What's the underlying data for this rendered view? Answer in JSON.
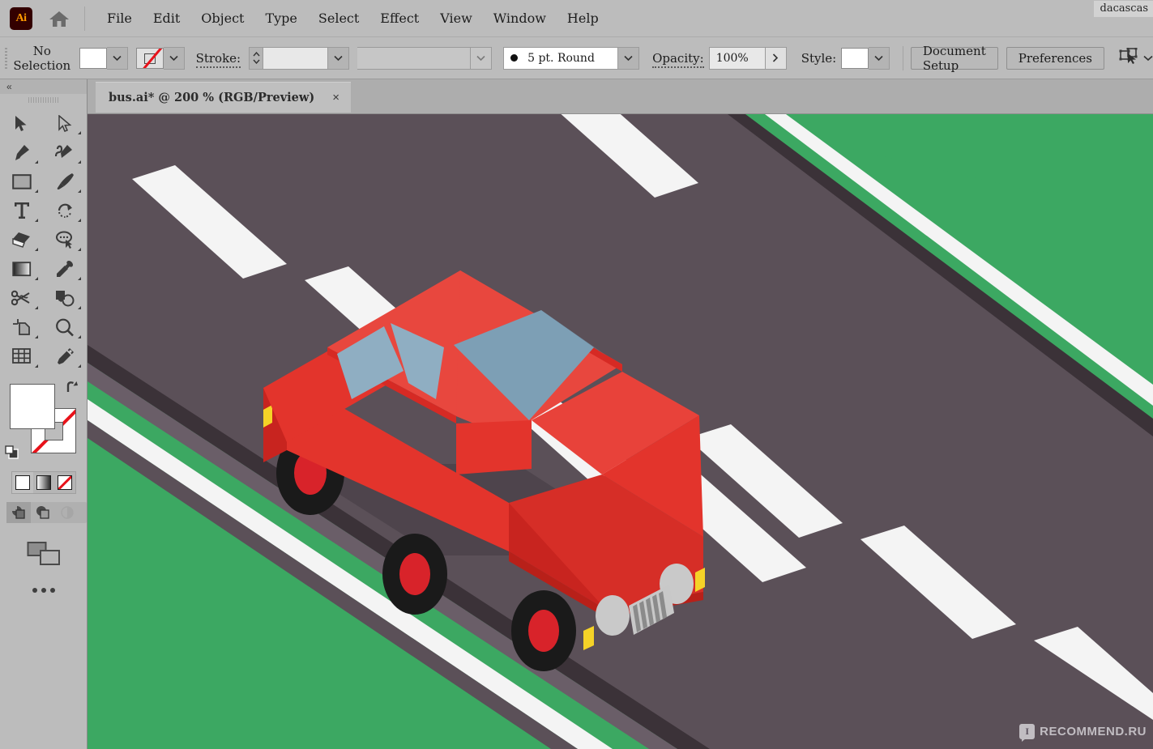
{
  "app": {
    "name": "Adobe Illustrator",
    "logo_text": "Ai",
    "user_tag": "dacascas",
    "accent_color": "#1473c8"
  },
  "menubar": {
    "items": [
      {
        "label": "File",
        "name": "menu-file"
      },
      {
        "label": "Edit",
        "name": "menu-edit"
      },
      {
        "label": "Object",
        "name": "menu-object"
      },
      {
        "label": "Type",
        "name": "menu-type"
      },
      {
        "label": "Select",
        "name": "menu-select"
      },
      {
        "label": "Effect",
        "name": "menu-effect"
      },
      {
        "label": "View",
        "name": "menu-view"
      },
      {
        "label": "Window",
        "name": "menu-window"
      },
      {
        "label": "Help",
        "name": "menu-help"
      }
    ],
    "home_icon": "home-icon"
  },
  "controlbar": {
    "selection_status": "No Selection",
    "fill_swatch": "#FFFFFF",
    "stroke_swatch": "none",
    "stroke_label": "Stroke:",
    "stroke_weight": "",
    "stroke_profile": "",
    "brush_definition": "5 pt. Round",
    "opacity_label": "Opacity:",
    "opacity_value": "100%",
    "style_label": "Style:",
    "style_swatch": "#FFFFFF",
    "document_setup": "Document Setup",
    "preferences": "Preferences",
    "select_similar_icon": "select-similar-objects-icon"
  },
  "tabs": {
    "active": 0,
    "items": [
      {
        "title": "bus.ai* @ 200 % (RGB/Preview)",
        "close": "×"
      }
    ]
  },
  "toolpanel": {
    "collapse_label": "«",
    "tools": [
      {
        "name": "selection-tool",
        "label": "Selection"
      },
      {
        "name": "direct-selection-tool",
        "label": "Direct Selection"
      },
      {
        "name": "pen-tool",
        "label": "Pen"
      },
      {
        "name": "curvature-tool",
        "label": "Curvature"
      },
      {
        "name": "rectangle-tool",
        "label": "Rectangle"
      },
      {
        "name": "paintbrush-tool",
        "label": "Paintbrush"
      },
      {
        "name": "type-tool",
        "label": "Type"
      },
      {
        "name": "rotate-tool",
        "label": "Rotate"
      },
      {
        "name": "eraser-tool",
        "label": "Eraser"
      },
      {
        "name": "lasso-tool",
        "label": "Lasso"
      },
      {
        "name": "gradient-tool",
        "label": "Gradient"
      },
      {
        "name": "eyedropper-tool",
        "label": "Eyedropper"
      },
      {
        "name": "scissors-tool",
        "label": "Scissors"
      },
      {
        "name": "shape-builder-tool",
        "label": "Shape Builder"
      },
      {
        "name": "artboard-tool",
        "label": "Artboard"
      },
      {
        "name": "zoom-tool",
        "label": "Zoom"
      },
      {
        "name": "perspective-grid-tool",
        "label": "Perspective Grid"
      },
      {
        "name": "free-transform-tool",
        "label": "Free Transform"
      }
    ],
    "fill_color": "#FFFFFF",
    "stroke_color": "none",
    "color_modes": [
      "color-swatch",
      "gradient-swatch",
      "none-swatch"
    ],
    "draw_modes": [
      "draw-normal",
      "draw-behind",
      "draw-inside"
    ],
    "screen_mode": "change-screen-mode",
    "more_label": "•••"
  },
  "artwork": {
    "description": "Isometric red car on a grey asphalt road with white dashed lane markings and green grass verges",
    "colors": {
      "grass": "#3CA862",
      "road": "#5B5058",
      "road_edge_dark": "#3B3238",
      "road_shadow": "#4A4048",
      "lane_marking": "#F4F4F4",
      "car_body": "#E3342C",
      "car_body_light": "#E8423A",
      "car_roof": "#E8473E",
      "car_side_dark": "#C8241F",
      "glass": "#8FAEC2",
      "glass_dark": "#7D9FB5",
      "tire": "#1A1A1A",
      "wheel_hub": "#D8232A",
      "headlight": "#C9C9C9",
      "indicator": "#F5D327",
      "grille": "#C8C8C8",
      "shadow": "#4A4048"
    }
  },
  "watermark": {
    "badge": "I",
    "text": "RECOMMEND.RU"
  }
}
